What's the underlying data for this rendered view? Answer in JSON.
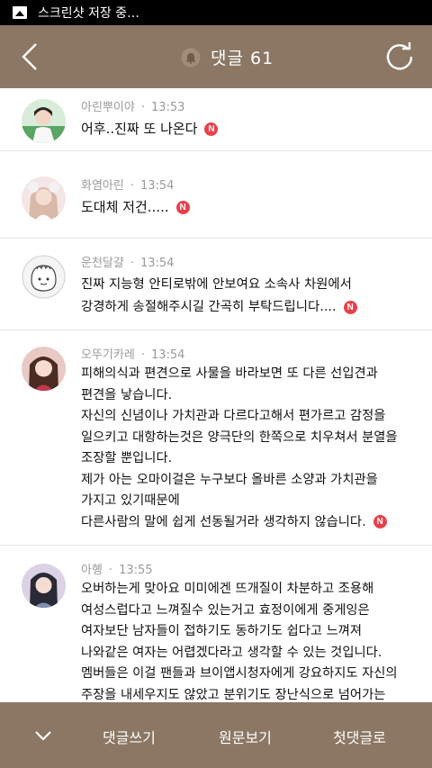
{
  "statusbar": {
    "text": "스크린샷 저장 중…"
  },
  "header": {
    "title": "댓글 61"
  },
  "comments": [
    {
      "author": "아린뿌이야",
      "time": "13:53",
      "lines": [
        "어후..진짜 또 나온다"
      ]
    },
    {
      "author": "화염아린",
      "time": "13:54",
      "lines": [
        "도대체 저건....."
      ]
    },
    {
      "author": "운천달걀",
      "time": "13:54",
      "lines": [
        "진짜 지능형 안티로밖에 안보여요 소속사 차원에서",
        "강경하게 송절해주시길 간곡히 부탁드립니다...."
      ]
    },
    {
      "author": "오뚜기카레",
      "time": "13:54",
      "lines": [
        "피해의식과 편견으로 사물을 바라보면 또 다른 선입견과",
        "편견을 낳습니다.",
        "자신의 신념이나 가치관과 다르다고해서 편가르고 감정을",
        "일으키고 대항하는것은 양극단의 한쪽으로 치우쳐서 분열을",
        "조장할 뿐입니다.",
        "제가 아는 오마이걸은 누구보다 올바른 소양과 가치관을",
        "가지고 있기때문에",
        "다른사람의 말에 쉽게 선동될거라 생각하지 않습니다."
      ]
    },
    {
      "author": "아혱",
      "time": "13:55",
      "lines": [
        "오버하는게 맞아요 미미에겐 뜨개질이 차분하고 조용해",
        "여성스럽다고 느껴질수 있는거고 효정이에게 중게잉은",
        "여자보단 남자들이 접하기도 동하기도 쉽다고 느껴져",
        "나와같은 여자는 어렵겠다라고 생각할 수 있는 것입니다.",
        "멤버들은 이걸 팬들과 브이앱시청자에게 강요하지도 자신의",
        "주장을 내세우지도 않았고 분위기도 장난식으로 넘어가는"
      ]
    }
  ],
  "footer": {
    "write": "댓글쓰기",
    "original": "원문보기",
    "first": "첫댓글로"
  },
  "badge": "N"
}
